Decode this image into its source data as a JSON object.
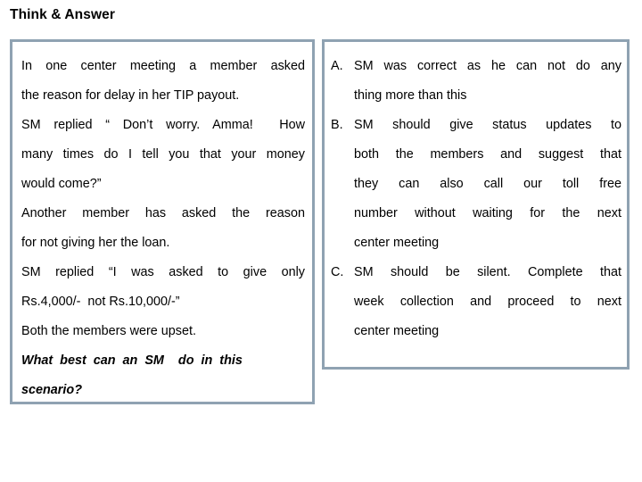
{
  "slide": {
    "title": "Think & Answer",
    "background_color": "#ffffff",
    "text_color": "#000000",
    "border_color": "#8fa2b2"
  },
  "scenario_panel": {
    "name": "scenario-box",
    "lines": [
      "In one center meeting a member asked",
      "the reason for delay in her TIP payout.",
      "SM replied “ Don’t worry. Amma!  How",
      "many times do I tell you that your money",
      "would come?”",
      "Another member has asked the reason",
      "for not giving her the loan.",
      "SM replied “I was asked to give only",
      "Rs.4,000/-  not Rs.10,000/-”",
      "Both the members were upset."
    ],
    "question_lines": [
      "What  best  can  an  SM    do  in  this",
      "scenario?"
    ]
  },
  "options_panel": {
    "name": "answer-options-box",
    "options": [
      {
        "marker": "A.",
        "lines": [
          "SM was correct as he can not do any",
          "thing more than this"
        ]
      },
      {
        "marker": "B.",
        "lines": [
          "SM should give status updates to",
          "both the members and suggest that",
          "they  can  also  call  our  toll  free",
          "number without waiting for the next",
          "center meeting"
        ]
      },
      {
        "marker": "C.",
        "lines": [
          "SM should be silent. Complete that",
          "week collection and proceed to next",
          "center meeting"
        ]
      }
    ]
  }
}
